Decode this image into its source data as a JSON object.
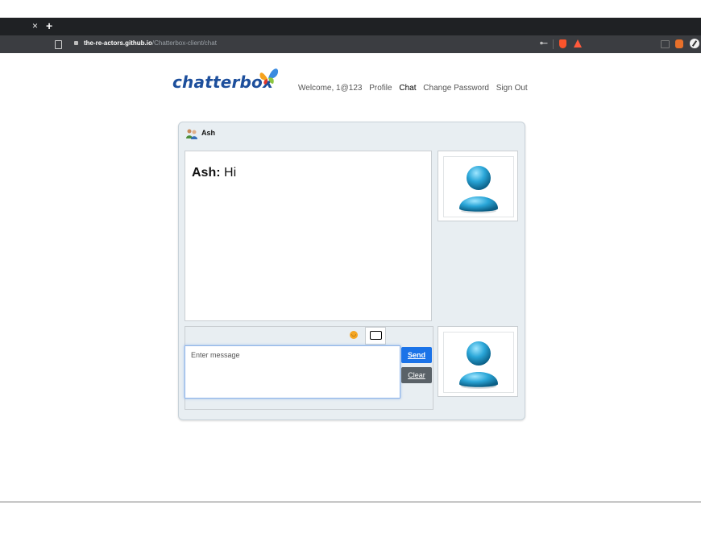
{
  "browser": {
    "tab_close": "×",
    "new_tab": "+",
    "url_host": "the-re-actors.github.io",
    "url_path": "/Chatterbox-client/chat",
    "icons": [
      "bookmark-icon",
      "lock-icon",
      "key-icon",
      "brave-shield-icon",
      "rewards-icon",
      "extension-icon",
      "extension-icon",
      "extension-icon"
    ]
  },
  "header": {
    "logo_text": "chatterbox",
    "nav": {
      "welcome": "Welcome, 1@123",
      "profile": "Profile",
      "chat": "Chat",
      "change_password": "Change Password",
      "sign_out": "Sign Out"
    }
  },
  "chat": {
    "contact_name": "Ash",
    "messages": [
      {
        "sender": "Ash:",
        "text": "Hi"
      }
    ],
    "compose": {
      "placeholder": "Enter message",
      "send_label": "Send",
      "clear_label": "Clear"
    }
  },
  "colors": {
    "logo_blue": "#1d4f9c",
    "send_button": "#1b73e8",
    "clear_button": "#5a6268",
    "panel_bg": "#e8eef2"
  }
}
